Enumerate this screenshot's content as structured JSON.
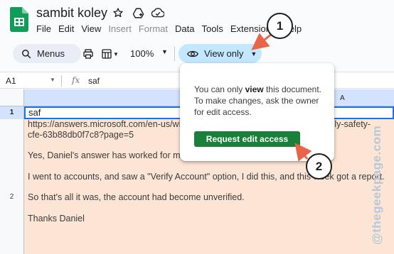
{
  "document": {
    "title": "sambit koley"
  },
  "menu": [
    "File",
    "Edit",
    "View",
    "Insert",
    "Format",
    "Data",
    "Tools",
    "Extensions",
    "Help"
  ],
  "menu_disabled": [
    "Insert",
    "Format"
  ],
  "toolbar": {
    "menus_label": "Menus",
    "zoom": "100%",
    "view_only_label": "View only"
  },
  "formula_bar": {
    "cell_ref": "A1",
    "fx": "fx",
    "value": "saf"
  },
  "grid": {
    "column_header": "A",
    "row_numbers": [
      "1",
      "2"
    ],
    "cell_a1": "saf",
    "cell_a2_lines": [
      "https://answers.microsoft.com/en-us/windows/forum/all/microsoft-security/family-safety-",
      "cfe-63b88db0f7c8?page=5",
      "Yes, Daniel's answer has worked for me.",
      "I went to accounts, and saw a \"Verify Account\" option, I did this, and this week got a report.",
      "So that's all it was, the account had become unverified.",
      "Thanks Daniel"
    ]
  },
  "popover": {
    "message_pre": "You can only ",
    "message_bold": "view",
    "message_post": " this document. To make changes, ask the owner for edit access.",
    "request_button": "Request edit access"
  },
  "callouts": [
    "1",
    "2"
  ],
  "watermark": "@thegeekpage.com",
  "colors": {
    "view_only_bg": "#c2e7ff",
    "request_button_bg": "#188038",
    "selection_border": "#1a73e8",
    "cell_highlight": "#fce5d5",
    "arrow": "#e8654a",
    "sheets_green": "#0f9d58"
  },
  "icons": [
    "sheets-logo-icon",
    "star-icon",
    "move-to-drive-icon",
    "cloud-status-icon",
    "search-icon",
    "print-icon",
    "format-icon",
    "eye-icon",
    "fx-icon"
  ]
}
